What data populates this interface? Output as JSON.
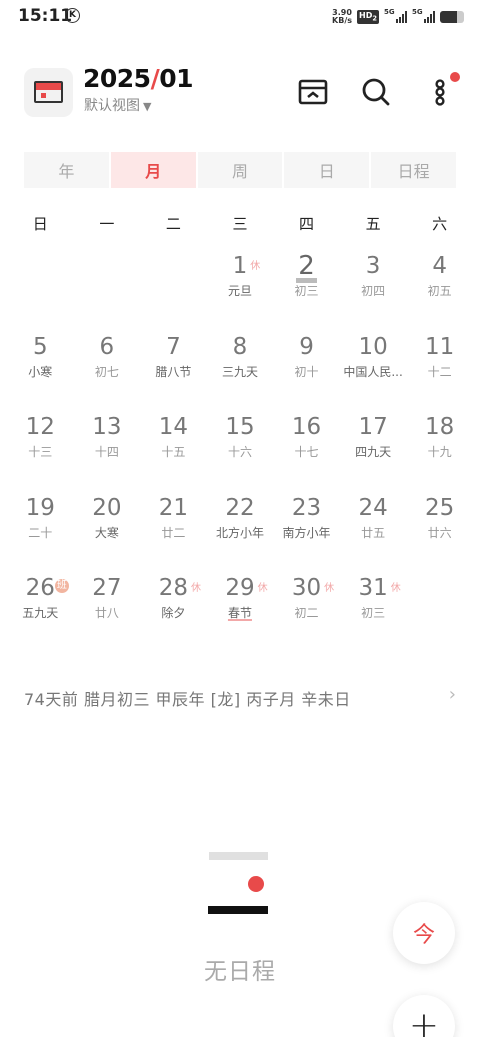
{
  "status_bar": {
    "time": "15:11",
    "k_icon": "K",
    "speed_value": "3.90",
    "speed_unit": "KB/s",
    "hd_label": "HD",
    "hd_sub": "2",
    "sig1_label": "5G",
    "sig2_label": "5G",
    "battery_level": 0.7
  },
  "header": {
    "title_year": "2025",
    "title_slash": "/",
    "title_month": "01",
    "view_label": "默认视图",
    "caret": "▼"
  },
  "tabs": [
    {
      "label": "年",
      "active": false
    },
    {
      "label": "月",
      "active": true
    },
    {
      "label": "周",
      "active": false
    },
    {
      "label": "日",
      "active": false
    },
    {
      "label": "日程",
      "active": false
    }
  ],
  "weekdays": [
    "日",
    "一",
    "二",
    "三",
    "四",
    "五",
    "六"
  ],
  "weeks": [
    [
      null,
      null,
      null,
      {
        "day": "1",
        "sub": "元旦",
        "rest": "休",
        "sub_hl": true
      },
      {
        "day": "2",
        "sub": "初三",
        "today": true
      },
      {
        "day": "3",
        "sub": "初四"
      },
      {
        "day": "4",
        "sub": "初五"
      }
    ],
    [
      {
        "day": "5",
        "sub": "小寒",
        "sub_hl": true
      },
      {
        "day": "6",
        "sub": "初七"
      },
      {
        "day": "7",
        "sub": "腊八节",
        "sub_hl": true
      },
      {
        "day": "8",
        "sub": "三九天",
        "sub_hl": true
      },
      {
        "day": "9",
        "sub": "初十"
      },
      {
        "day": "10",
        "sub": "中国人民...",
        "sub_hl": true
      },
      {
        "day": "11",
        "sub": "十二"
      }
    ],
    [
      {
        "day": "12",
        "sub": "十三"
      },
      {
        "day": "13",
        "sub": "十四"
      },
      {
        "day": "14",
        "sub": "十五"
      },
      {
        "day": "15",
        "sub": "十六"
      },
      {
        "day": "16",
        "sub": "十七"
      },
      {
        "day": "17",
        "sub": "四九天",
        "sub_hl": true
      },
      {
        "day": "18",
        "sub": "十九"
      }
    ],
    [
      {
        "day": "19",
        "sub": "二十"
      },
      {
        "day": "20",
        "sub": "大寒",
        "sub_hl": true
      },
      {
        "day": "21",
        "sub": "廿二"
      },
      {
        "day": "22",
        "sub": "北方小年",
        "sub_hl": true
      },
      {
        "day": "23",
        "sub": "南方小年",
        "sub_hl": true
      },
      {
        "day": "24",
        "sub": "廿五"
      },
      {
        "day": "25",
        "sub": "廿六"
      }
    ],
    [
      {
        "day": "26",
        "sub": "五九天",
        "rest": "班",
        "work": true,
        "sub_hl": true
      },
      {
        "day": "27",
        "sub": "廿八"
      },
      {
        "day": "28",
        "sub": "除夕",
        "rest": "休",
        "sub_hl": true
      },
      {
        "day": "29",
        "sub": "春节",
        "rest": "休",
        "sub_hl": true,
        "underline": true
      },
      {
        "day": "30",
        "sub": "初二",
        "rest": "休"
      },
      {
        "day": "31",
        "sub": "初三",
        "rest": "休"
      },
      null
    ]
  ],
  "lunar_info": "74天前   腊月初三   甲辰年 [龙] 丙子月 辛未日",
  "lunar_arrow": "›",
  "empty_text": "无日程",
  "fab_today": "今",
  "fab_add": "+",
  "colors": {
    "accent": "#e84a4a",
    "tab_active_bg": "#fde7e7",
    "rest_mark": "#f2a8a8"
  },
  "icons": {
    "app": "calendar-app-icon",
    "inbox": "inbox-icon",
    "search": "search-icon",
    "more": "more-icon"
  }
}
